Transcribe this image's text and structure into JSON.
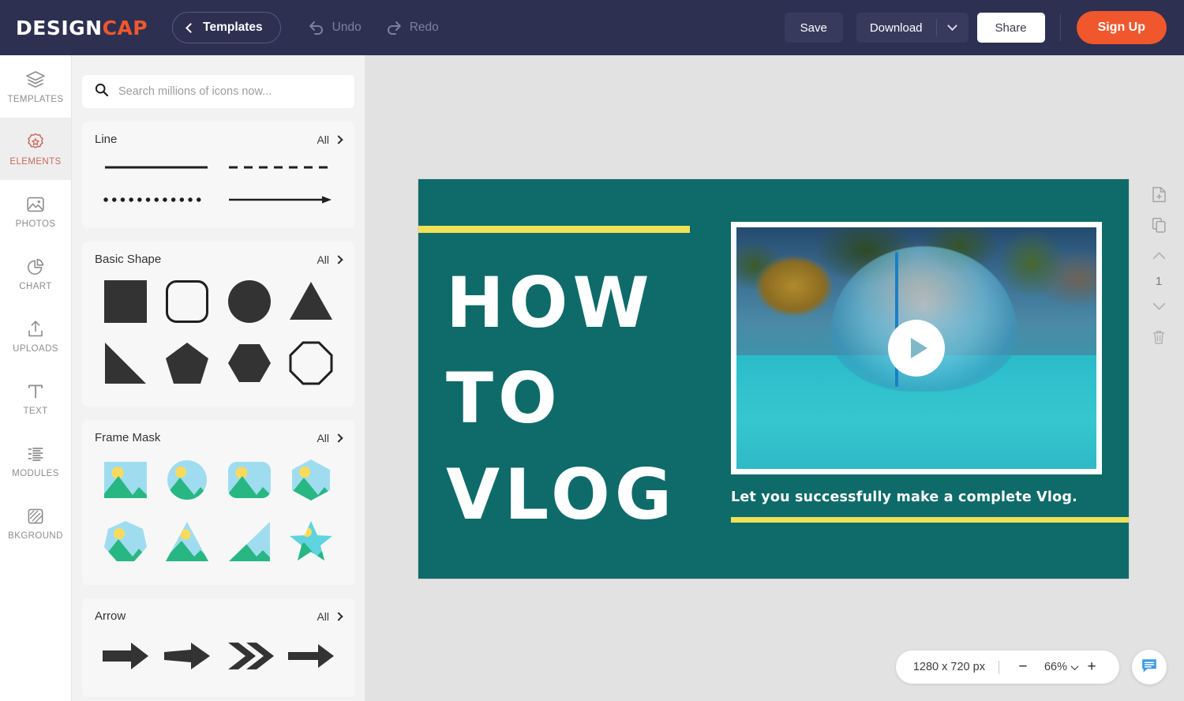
{
  "header": {
    "logo_part1": "DESIGN",
    "logo_part2": "CAP",
    "templates_label": "Templates",
    "undo_label": "Undo",
    "redo_label": "Redo",
    "save_label": "Save",
    "download_label": "Download",
    "share_label": "Share",
    "signup_label": "Sign Up",
    "bg_color": "#2d3051",
    "accent_color": "#f0572c"
  },
  "rail": {
    "items": [
      {
        "label": "TEMPLATES",
        "icon": "layers-icon",
        "active": false
      },
      {
        "label": "ELEMENTS",
        "icon": "badge-star-icon",
        "active": true
      },
      {
        "label": "PHOTOS",
        "icon": "image-icon",
        "active": false
      },
      {
        "label": "CHART",
        "icon": "pie-chart-icon",
        "active": false
      },
      {
        "label": "UPLOADS",
        "icon": "upload-icon",
        "active": false
      },
      {
        "label": "TEXT",
        "icon": "text-t-icon",
        "active": false
      },
      {
        "label": "MODULES",
        "icon": "list-icon",
        "active": false
      },
      {
        "label": "BKGROUND",
        "icon": "background-icon",
        "active": false
      }
    ],
    "active_color": "#c96a5a"
  },
  "panel": {
    "search_placeholder": "Search millions of icons now...",
    "search_value": "",
    "all_label": "All",
    "sections": [
      {
        "title": "Line",
        "all": "All"
      },
      {
        "title": "Basic Shape",
        "all": "All"
      },
      {
        "title": "Frame Mask",
        "all": "All"
      },
      {
        "title": "Arrow",
        "all": "All"
      }
    ]
  },
  "canvas": {
    "headline_line1": "HOW",
    "headline_line2": "TO",
    "headline_line3": "VLOG",
    "tagline": "Let you successfully make a complete Vlog.",
    "bg_color": "#0e6b69",
    "accent_color": "#efe158",
    "text_color": "#ffffff"
  },
  "toolstrip": {
    "add_page_label": "add-page",
    "duplicate_label": "duplicate-page",
    "prev_label": "previous-page",
    "page_number": "1",
    "next_label": "next-page",
    "delete_label": "delete-page"
  },
  "bottombar": {
    "canvas_size": "1280 x 720 px",
    "zoom_out": "−",
    "zoom_value": "66%",
    "zoom_in": "+",
    "chat_icon": "chat-bubble-icon"
  }
}
